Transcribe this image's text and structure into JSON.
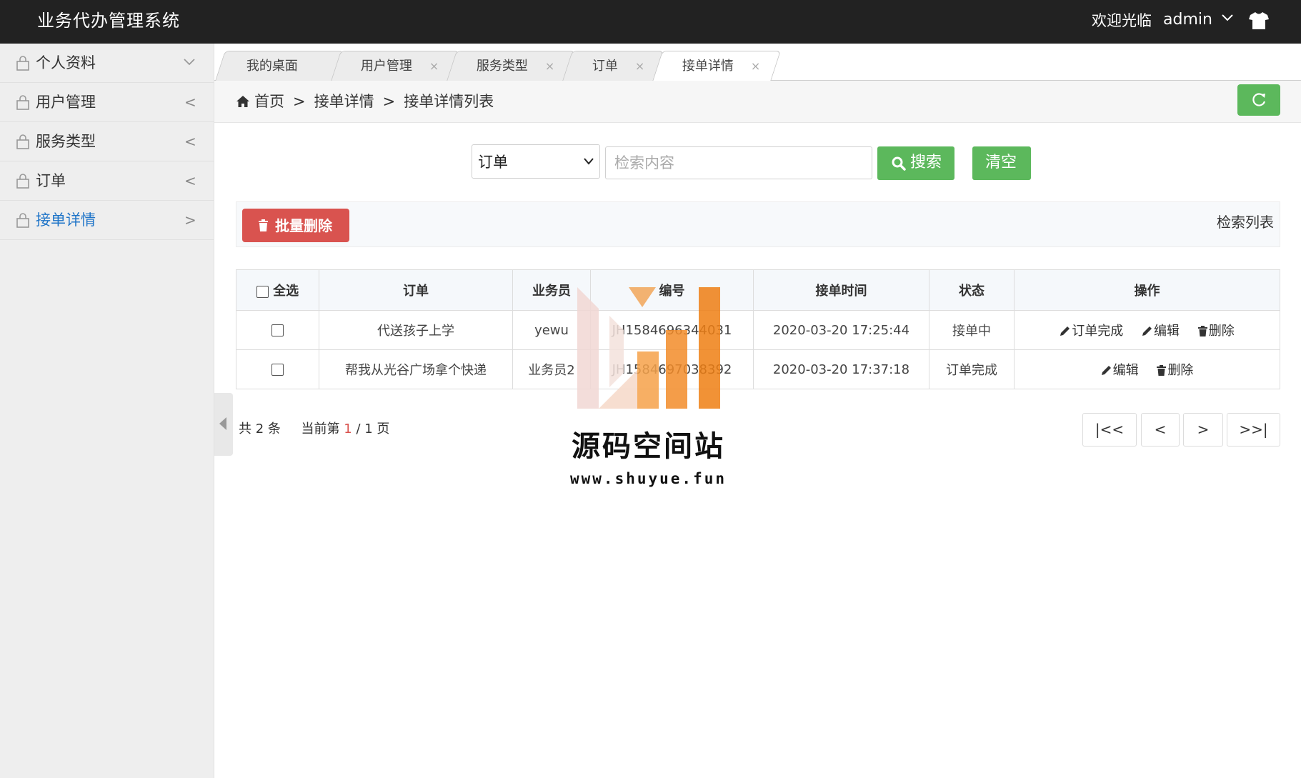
{
  "header": {
    "app_title": "业务代办管理系统",
    "welcome": "欢迎光临",
    "username": "admin",
    "theme_icon": "tshirt-icon"
  },
  "sidebar": {
    "items": [
      {
        "label": "个人资料",
        "arrow": "chevron-down",
        "active": false
      },
      {
        "label": "用户管理",
        "arrow": "<",
        "active": false
      },
      {
        "label": "服务类型",
        "arrow": "<",
        "active": false
      },
      {
        "label": "订单",
        "arrow": "<",
        "active": false
      },
      {
        "label": "接单详情",
        "arrow": ">",
        "active": true
      }
    ]
  },
  "tabs": [
    {
      "label": "我的桌面",
      "closable": false
    },
    {
      "label": "用户管理",
      "closable": true,
      "close": "×"
    },
    {
      "label": "服务类型",
      "closable": true,
      "close": "×"
    },
    {
      "label": "订单",
      "closable": true,
      "close": "×"
    },
    {
      "label": "接单详情",
      "closable": true,
      "close": "×",
      "active": true
    }
  ],
  "breadcrumb": {
    "home": "首页",
    "sep": ">",
    "level1": "接单详情",
    "level2": "接单详情列表"
  },
  "search": {
    "field_selected": "订单",
    "placeholder": "检索内容",
    "value": "",
    "search_label": "搜索",
    "clear_label": "清空"
  },
  "toolbar": {
    "batch_delete_label": "批量删除",
    "list_label": "检索列表"
  },
  "table": {
    "headers": {
      "select_all": "全选",
      "order": "订单",
      "staff": "业务员",
      "number": "编号",
      "time": "接单时间",
      "status": "状态",
      "actions": "操作"
    },
    "rows": [
      {
        "order": "代送孩子上学",
        "staff": "yewu",
        "number": "JH1584696344031",
        "time": "2020-03-20 17:25:44",
        "status": "接单中",
        "complete_label": "订单完成",
        "edit_label": "编辑",
        "delete_label": "删除"
      },
      {
        "order": "帮我从光谷广场拿个快递",
        "staff": "业务员2",
        "number": "JH1584697038392",
        "time": "2020-03-20 17:37:18",
        "status": "订单完成",
        "edit_label": "编辑",
        "delete_label": "删除"
      }
    ]
  },
  "pagination": {
    "total_prefix": "共",
    "total": "2",
    "total_suffix": "条",
    "current_prefix": "当前第",
    "current": "1",
    "total_pages_text": "/ 1 页",
    "first": "|<<",
    "prev": "<",
    "next": ">",
    "last": ">>|"
  },
  "watermark": {
    "title": "源码空间站",
    "url": "www.shuyue.fun"
  },
  "colors": {
    "header_bg": "#222222",
    "accent_green": "#5cb85c",
    "danger_red": "#d9534f",
    "active_link": "#1e74c8",
    "watermark_orange": "#f28a1e"
  }
}
